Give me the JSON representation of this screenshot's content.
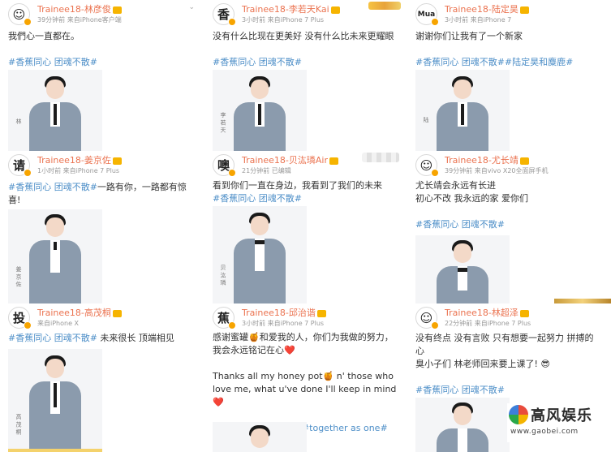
{
  "posts": [
    {
      "avatar": "☺",
      "username": "Trainee18-林彦俊",
      "meta": "39分钟前  来自iPhone客户端",
      "lines": [
        {
          "text": "我們心一直都在。",
          "tag": ""
        },
        {
          "text": "",
          "tag": ""
        },
        {
          "text": "",
          "tag": "#香蕉同心 团魂不散#"
        }
      ],
      "signature": "林"
    },
    {
      "avatar": "香",
      "username": "Trainee18-李若天Kai",
      "meta": "3小时前  来自iPhone 7 Plus",
      "lines": [
        {
          "text": "没有什么比现在更美好 没有什么比未来更耀眼",
          "tag": ""
        },
        {
          "text": "",
          "tag": ""
        },
        {
          "text": "",
          "tag": "#香蕉同心 团魂不散#"
        }
      ],
      "signature": "李\n若\n天"
    },
    {
      "avatar": "Mua",
      "username": "Trainee18-陆定昊",
      "meta": "3小时前  来自iPhone 7",
      "lines": [
        {
          "text": "谢谢你们让我有了一个新家",
          "tag": ""
        },
        {
          "text": "",
          "tag": ""
        },
        {
          "text": "",
          "tag": "#香蕉同心 团魂不散##陆定昊和麋鹿#"
        }
      ],
      "signature": "陆"
    },
    {
      "avatar": "请",
      "username": "Trainee18-姜京佐",
      "meta": "1小时前  来自iPhone 7 Plus",
      "lines": [
        {
          "text": "一路有你，一路都有惊",
          "tag": "#香蕉同心 团魂不散#"
        },
        {
          "text": "喜!",
          "tag": ""
        }
      ],
      "signature": "姜\n京\n佐"
    },
    {
      "avatar": "噢",
      "username": "Trainee18-贝汯璘Air",
      "meta": "21分钟前  已编辑",
      "lines": [
        {
          "text": "看到你们一直在身边，我看到了我们的未来",
          "tag": ""
        },
        {
          "text": "",
          "tag": "#香蕉同心 团魂不散#"
        }
      ],
      "signature": "贝\n汯\n璘"
    },
    {
      "avatar": "☺",
      "username": "Trainee18-尤长靖",
      "meta": "39分钟前  来自vivo X20全面屏手机",
      "lines": [
        {
          "text": "尤长靖会永远有长进",
          "tag": ""
        },
        {
          "text": "初心不改 我永远的家 爱你们",
          "tag": ""
        },
        {
          "text": "",
          "tag": ""
        },
        {
          "text": "",
          "tag": "#香蕉同心 团魂不散#"
        }
      ],
      "signature": ""
    },
    {
      "avatar": "投",
      "username": "Trainee18-高茂桐",
      "meta": "来自iPhone X",
      "lines": [
        {
          "text": " 未来很长 顶端相见",
          "tag": "#香蕉同心 团魂不散#"
        }
      ],
      "signature": "高\n茂\n桐"
    },
    {
      "avatar": "蕉",
      "username": "Trainee18-邱治谐",
      "meta": "3小时前  来自iPhone 7 Plus",
      "lines": [
        {
          "text": "感谢蜜罐🍯和爱我的人，你们为我做的努力，",
          "tag": ""
        },
        {
          "text": "我会永远铭记在心❤️",
          "tag": ""
        },
        {
          "text": "",
          "tag": ""
        },
        {
          "text": "Thanks all my honey pot🍯 n' those who",
          "tag": ""
        },
        {
          "text": "love me, what u've done I'll keep in mind❤️",
          "tag": ""
        },
        {
          "text": "",
          "tag": ""
        },
        {
          "text": "",
          "tag": "#香蕉同心 团魂不散##together as one#"
        }
      ],
      "signature": ""
    },
    {
      "avatar": "☺",
      "username": "Trainee18-林超泽",
      "meta": "22分钟前  来自iPhone 7 Plus",
      "lines": [
        {
          "text": "没有终点 没有言败 只有想要一起努力 拼搏的",
          "tag": ""
        },
        {
          "text": "心",
          "tag": ""
        },
        {
          "text": "臭小子们 林老师回来要上课了! 😎",
          "tag": ""
        },
        {
          "text": "",
          "tag": ""
        },
        {
          "text": "",
          "tag": "#香蕉同心 团魂不散#"
        }
      ],
      "signature": ""
    }
  ],
  "watermark": {
    "name": "高风娱乐",
    "url": "www.gaobei.com"
  },
  "colors": {
    "username": "#eb7350",
    "hashtag": "#4e8fc8",
    "meta": "#999999",
    "suit": "#8b9bad"
  }
}
